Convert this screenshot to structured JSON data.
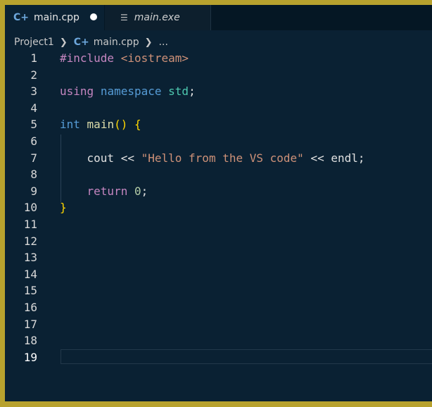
{
  "tabs": [
    {
      "label": "main.cpp",
      "icon": "cpp-icon",
      "modified": true,
      "active": true
    },
    {
      "label": "main.exe",
      "icon": "file-lines-icon",
      "active": false
    }
  ],
  "breadcrumb": {
    "project": "Project1",
    "file": "main.cpp",
    "more": "..."
  },
  "editor": {
    "line_numbers": [
      "1",
      "2",
      "3",
      "4",
      "5",
      "6",
      "7",
      "8",
      "9",
      "10",
      "11",
      "12",
      "13",
      "14",
      "15",
      "16",
      "17",
      "18",
      "19"
    ],
    "lines": {
      "l1_directive": "#include",
      "l1_header": "<iostream>",
      "l3_using": "using",
      "l3_namespace": "namespace",
      "l3_std": "std",
      "l3_semi": ";",
      "l5_int": "int",
      "l5_main": "main",
      "l5_parens": "()",
      "l5_brace": "{",
      "l7_cout": "cout",
      "l7_op1": "<<",
      "l7_string": "\"Hello from the VS code\"",
      "l7_op2": "<<",
      "l7_endl": "endl",
      "l7_semi": ";",
      "l9_return": "return",
      "l9_zero": "0",
      "l9_semi": ";",
      "l10_brace": "}"
    }
  },
  "colors": {
    "editor_bg": "#0a2133",
    "frame_border": "#b8a22e",
    "keyword": "#c586c0",
    "string": "#ce9178",
    "bracket": "#ffd700"
  }
}
